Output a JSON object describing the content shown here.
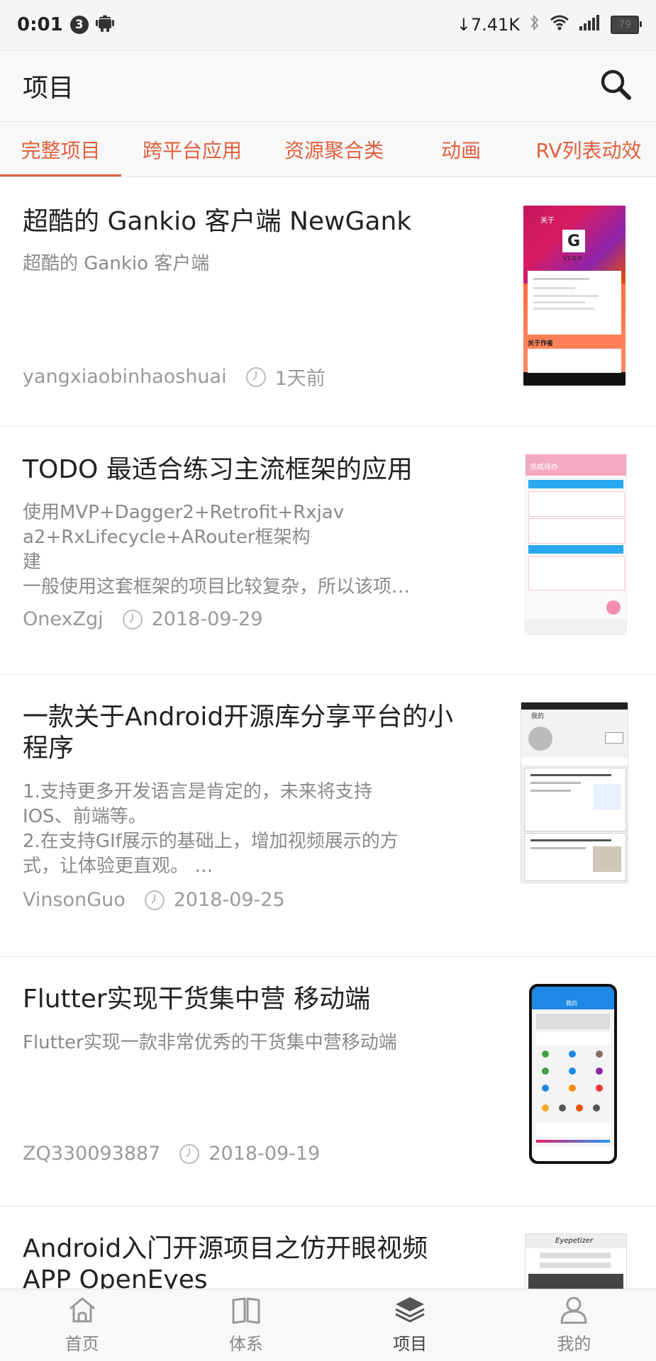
{
  "status_bar": {
    "time": "0:01",
    "notif_count": "3",
    "net_speed": "7.41K",
    "battery": "79"
  },
  "app_bar": {
    "title": "项目"
  },
  "tabs": [
    {
      "label": "完整项目"
    },
    {
      "label": "跨平台应用"
    },
    {
      "label": "资源聚合类"
    },
    {
      "label": "动画"
    },
    {
      "label": "RV列表动效"
    }
  ],
  "items": [
    {
      "title": "超酷的 Gankio 客户端 NewGank",
      "desc": "超酷的 Gankio 客户端",
      "author": "yangxiaobinhaoshuai",
      "time": "1天前",
      "thumb": {
        "header": "关于",
        "logo": "G",
        "version": "V1.0.0",
        "section": "关于作者"
      }
    },
    {
      "title": " TODO 最适合练习主流框架的应用",
      "desc": "使用MVP+Dagger2+Retrofit+Rxjava2+RxLifecycle+ARouter框架构建\n一般使用这套框架的项目比较复杂，所以该项…",
      "desc_lines": [
        "使用MVP+Dagger2+Retrofit+Rxjav",
        "a2+RxLifecycle+ARouter框架构",
        "建",
        "一般使用这套框架的项目比较复杂，所以该项…"
      ],
      "author": "OnexZgj",
      "time": "2018-09-29",
      "thumb": {
        "header": "完成待办"
      }
    },
    {
      "title": "一款关于Android开源库分享平台的小程序",
      "title_lines": [
        "一款关于Android开源库分享平台的小",
        "程序"
      ],
      "desc_lines": [
        "1.支持更多开发语言是肯定的，未来将支持",
        "IOS、前端等。",
        "2.在支持GIf展示的基础上，增加视频展示的方",
        "式，让体验更直观。 …"
      ],
      "author": "VinsonGuo",
      "time": "2018-09-25",
      "thumb": {
        "header": "我的"
      }
    },
    {
      "title": "Flutter实现干货集中营 移动端",
      "desc": "Flutter实现一款非常优秀的干货集中营移动端",
      "author": "ZQ330093887",
      "time": "2018-09-19",
      "thumb": {
        "header": "我的"
      }
    },
    {
      "title": "Android入门开源项目之仿开眼视频APP OpenEyes",
      "title_lines": [
        "Android入门开源项目之仿开眼视频",
        "APP OpenEyes"
      ],
      "thumb": {
        "header": "Eyepetizer"
      }
    }
  ],
  "bottom_nav": [
    {
      "label": "首页",
      "icon": "home-icon"
    },
    {
      "label": "体系",
      "icon": "book-icon"
    },
    {
      "label": "项目",
      "icon": "layers-icon"
    },
    {
      "label": "我的",
      "icon": "person-icon"
    }
  ],
  "colors": {
    "accent": "#e0603e",
    "secondary_text": "#8a8a8a",
    "meta_text": "#9a9a9a"
  }
}
